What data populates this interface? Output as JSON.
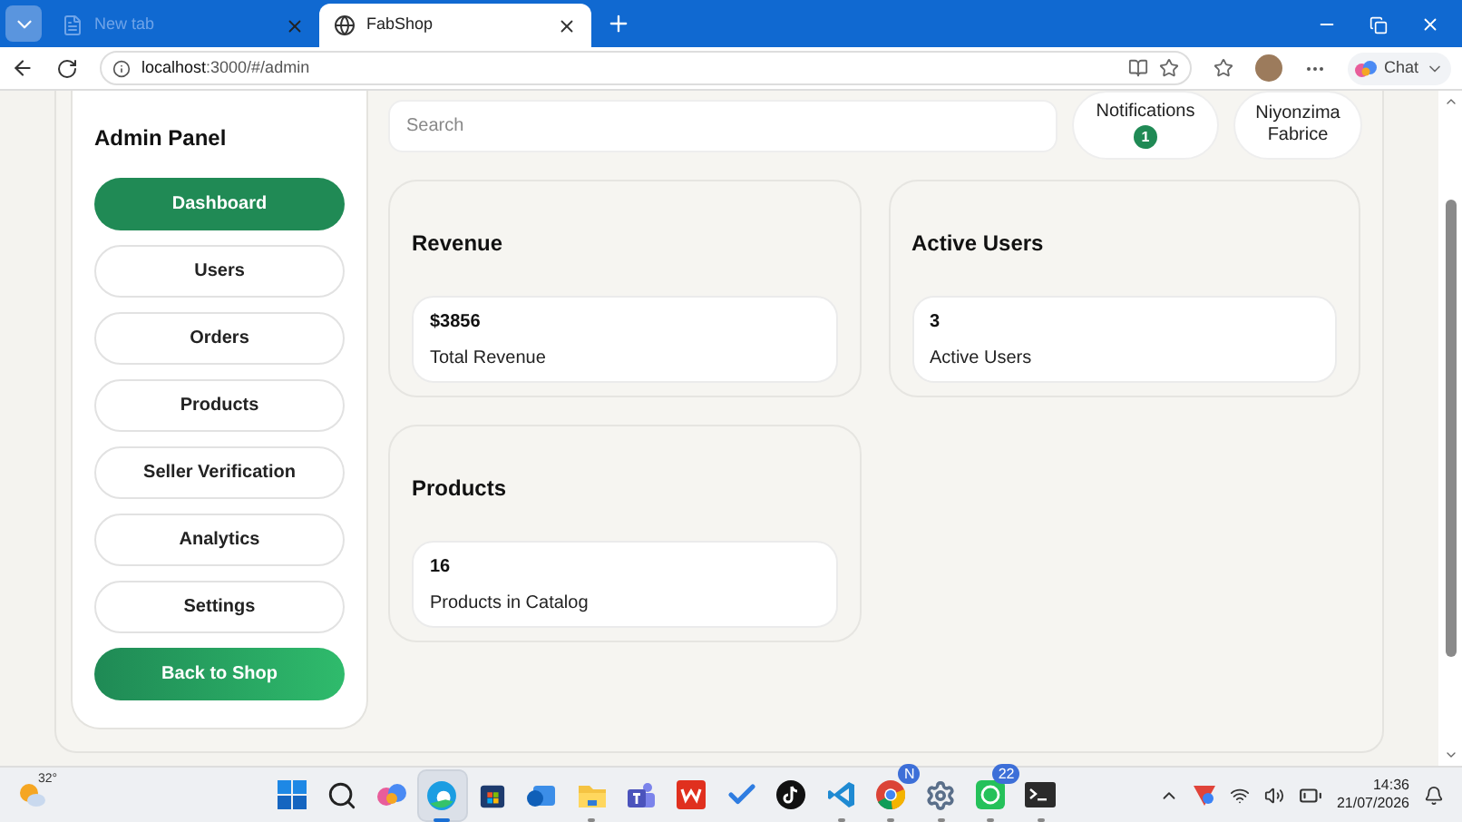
{
  "browser": {
    "tabs": [
      {
        "title": "New tab",
        "selected": false
      },
      {
        "title": "FabShop",
        "selected": true
      }
    ],
    "address": "**localhost**:3000/#/admin",
    "chat_button": "Chat"
  },
  "sidebar": {
    "title": "Admin Panel",
    "items": [
      {
        "label": "Dashboard",
        "selected": true
      },
      {
        "label": "Users",
        "selected": false
      },
      {
        "label": "Orders",
        "selected": false
      },
      {
        "label": "Products",
        "selected": false
      },
      {
        "label": "Seller Verification",
        "selected": false
      },
      {
        "label": "Analytics",
        "selected": false
      },
      {
        "label": "Settings",
        "selected": false
      }
    ],
    "back_button": "Back to Shop"
  },
  "header": {
    "search": {
      "placeholder": "Search"
    },
    "notifications": {
      "label": "Notifications",
      "count": "1"
    },
    "user": "Niyonzima Fabrice"
  },
  "cards": [
    {
      "title": "Revenue",
      "value": "$3856",
      "caption": "Total Revenue"
    },
    {
      "title": "Active Users",
      "value": "3",
      "caption": "Active Users"
    },
    {
      "title": "Products",
      "value": "16",
      "caption": "Products in Catalog"
    }
  ],
  "taskbar": {
    "weather": "32°",
    "apps": [
      {
        "kind": "start",
        "running": false,
        "active": false
      },
      {
        "kind": "search",
        "running": false,
        "active": false
      },
      {
        "kind": "copilot",
        "running": false,
        "active": false
      },
      {
        "kind": "edge",
        "running": true,
        "active": true
      },
      {
        "kind": "store",
        "running": false,
        "active": false
      },
      {
        "kind": "outlook",
        "running": false,
        "active": false
      },
      {
        "kind": "files",
        "running": true,
        "active": false
      },
      {
        "kind": "teams",
        "running": false,
        "active": false
      },
      {
        "kind": "office",
        "running": false,
        "active": false
      },
      {
        "kind": "todo",
        "running": false,
        "active": false
      },
      {
        "kind": "tiktok",
        "running": false,
        "active": false
      },
      {
        "kind": "vscode",
        "running": true,
        "active": false
      },
      {
        "kind": "chrome",
        "running": true,
        "active": false,
        "badge": "N"
      },
      {
        "kind": "settings",
        "running": true,
        "active": false
      },
      {
        "kind": "whatsapp",
        "running": true,
        "active": false,
        "badge": "22"
      },
      {
        "kind": "terminal",
        "running": true,
        "active": false
      }
    ],
    "time": "14:36",
    "date": "21/07/2026"
  }
}
